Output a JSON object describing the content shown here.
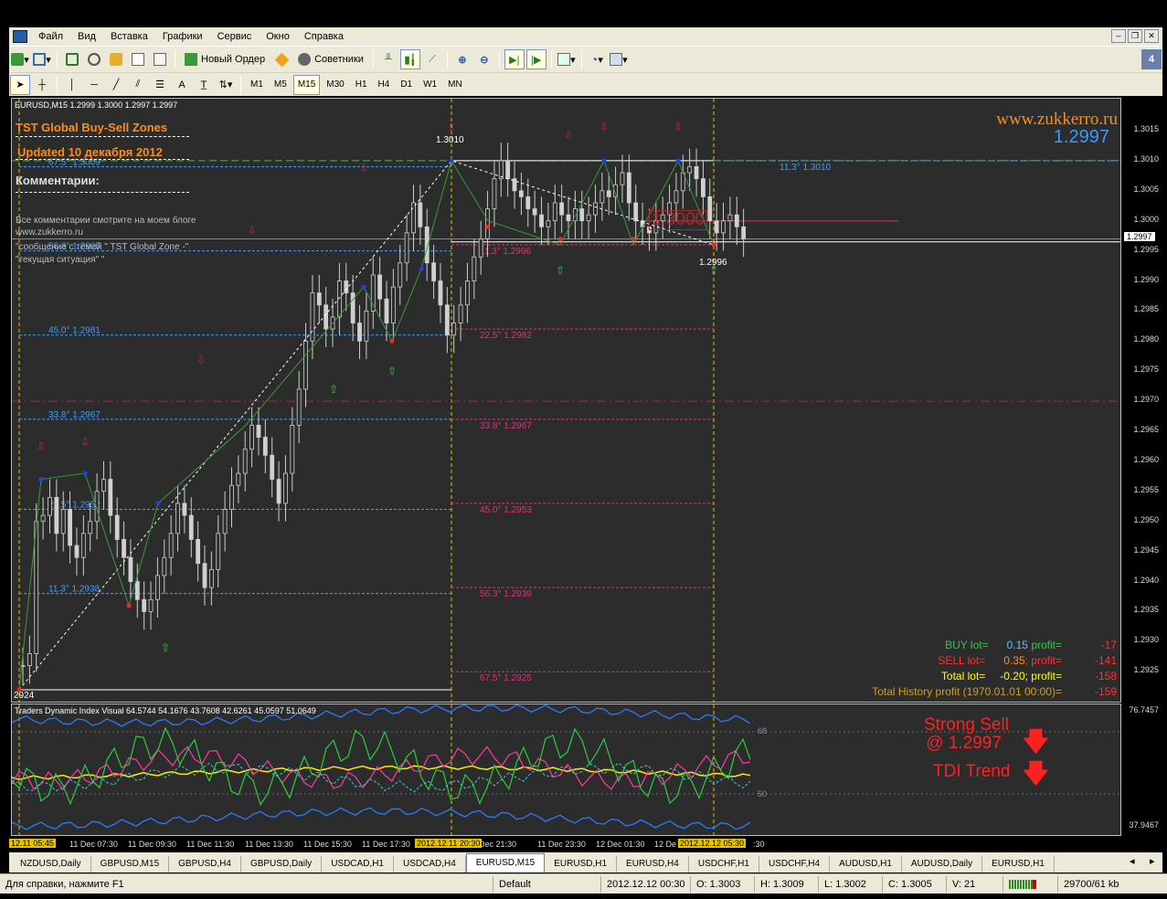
{
  "menu": {
    "items": [
      "Файл",
      "Вид",
      "Вставка",
      "Графики",
      "Сервис",
      "Окно",
      "Справка"
    ]
  },
  "toolbar": {
    "new_order": "Новый Ордер",
    "advisors": "Советники",
    "timeframes": [
      "M1",
      "M5",
      "M15",
      "M30",
      "H1",
      "H4",
      "D1",
      "W1",
      "MN"
    ],
    "active_timeframe": "M15"
  },
  "chart": {
    "header": "EURUSD,M15  1.2999 1.3000 1.2997 1.2997",
    "title1": "TST Global Buy-Sell Zones",
    "title2": "Updated 10 декабря 2012",
    "comments_title": "Комментарии:",
    "comment1": "Все комментарии смотрите на моем блоге",
    "comment2": "www.zukkerro.ru",
    "comment3": "\"сообщение с темой \" TST Global Zone -\"",
    "comment4": "\"текущая ситуация\" \"",
    "site": "www.zukkerro.ru",
    "price_big": "1.2997",
    "high_label": "1.3010",
    "low_label": "1.2996",
    "low_left": "2924",
    "big_level": "1.3000",
    "left_levels": [
      "67.5° 1.3009",
      "56.3° 1.2995",
      "45.0° 1.2981",
      "33.8° 1.2967",
      "22.5° 1.2952",
      "11.3° 1.2938"
    ],
    "right_levels": [
      "11.3° 1.3010",
      "11.3° 1.2996",
      "22.5° 1.2982",
      "33.8° 1.2967",
      "45.0° 1.2953",
      "56.3° 1.2939",
      "67.5° 1.2925"
    ],
    "price_scale": [
      "1.3015",
      "1.3010",
      "1.3005",
      "1.3000",
      "1.2995",
      "1.2990",
      "1.2985",
      "1.2980",
      "1.2975",
      "1.2970",
      "1.2965",
      "1.2960",
      "1.2955",
      "1.2950",
      "1.2945",
      "1.2940",
      "1.2935",
      "1.2930",
      "1.2925"
    ],
    "current_price": "1.2997",
    "stats": {
      "buy": {
        "label": "BUY  lot=",
        "lot": "0.15",
        "plabel": "profit=",
        "profit": "-17"
      },
      "sell": {
        "label": "SELL  lot=",
        "lot": "0.35",
        "plabel": "; profit=",
        "profit": "-141"
      },
      "total": {
        "label": "Total  lot=",
        "lot": "-0.20",
        "plabel": "; profit=",
        "profit": "-158"
      },
      "history": {
        "label": "Total History profit (1970.01.01 00:00)=",
        "profit": "-159"
      }
    },
    "colors": {
      "buy": "#2ecc40",
      "sell": "#ff3030",
      "total": "#ffff00",
      "history": "#d4a017",
      "bg": "#2c2c2c",
      "level_blue": "#3aa0ff",
      "level_pink": "#e0307a"
    }
  },
  "indicator": {
    "header": "Traders Dynamic Index Visual 64.5744 54.1676 43.7608 42.6261 45.0597 51.0649",
    "scale_top": "76.7457",
    "scale_bottom": "37.9467",
    "lvl68": "68",
    "lvl50": "50",
    "signal1": "Strong Sell",
    "signal2": "@ 1.2997",
    "signal3": "TDI Trend"
  },
  "time_axis": {
    "labels": [
      "11 Dec 07:30",
      "11 Dec 09:30",
      "11 Dec 11:30",
      "11 Dec 13:30",
      "11 Dec 15:30",
      "11 Dec 17:30",
      "Dec 21:30",
      "11 Dec 23:30",
      "12 Dec 01:30",
      "12 De"
    ],
    "hl_left": "12.11 05:45",
    "hl_mid": "2012.12.11 20:30",
    "hl_right": "2012.12.12 05:30",
    "tail": ":30"
  },
  "tabs": [
    "NZDUSD,Daily",
    "GBPUSD,M15",
    "GBPUSD,H4",
    "GBPUSD,Daily",
    "USDCAD,H1",
    "USDCAD,H4",
    "EURUSD,M15",
    "EURUSD,H1",
    "EURUSD,H4",
    "USDCHF,H1",
    "USDCHF,H4",
    "AUDUSD,H1",
    "AUDUSD,Daily",
    "EURUSD,H1"
  ],
  "active_tab": "EURUSD,M15",
  "status": {
    "help": "Для справки, нажмите F1",
    "profile": "Default",
    "datetime": "2012.12.12 00:30",
    "open": "O: 1.3003",
    "high": "H: 1.3009",
    "low": "L: 1.3002",
    "close": "C: 1.3005",
    "volume": "V: 21",
    "traffic": "29700/61 kb"
  }
}
